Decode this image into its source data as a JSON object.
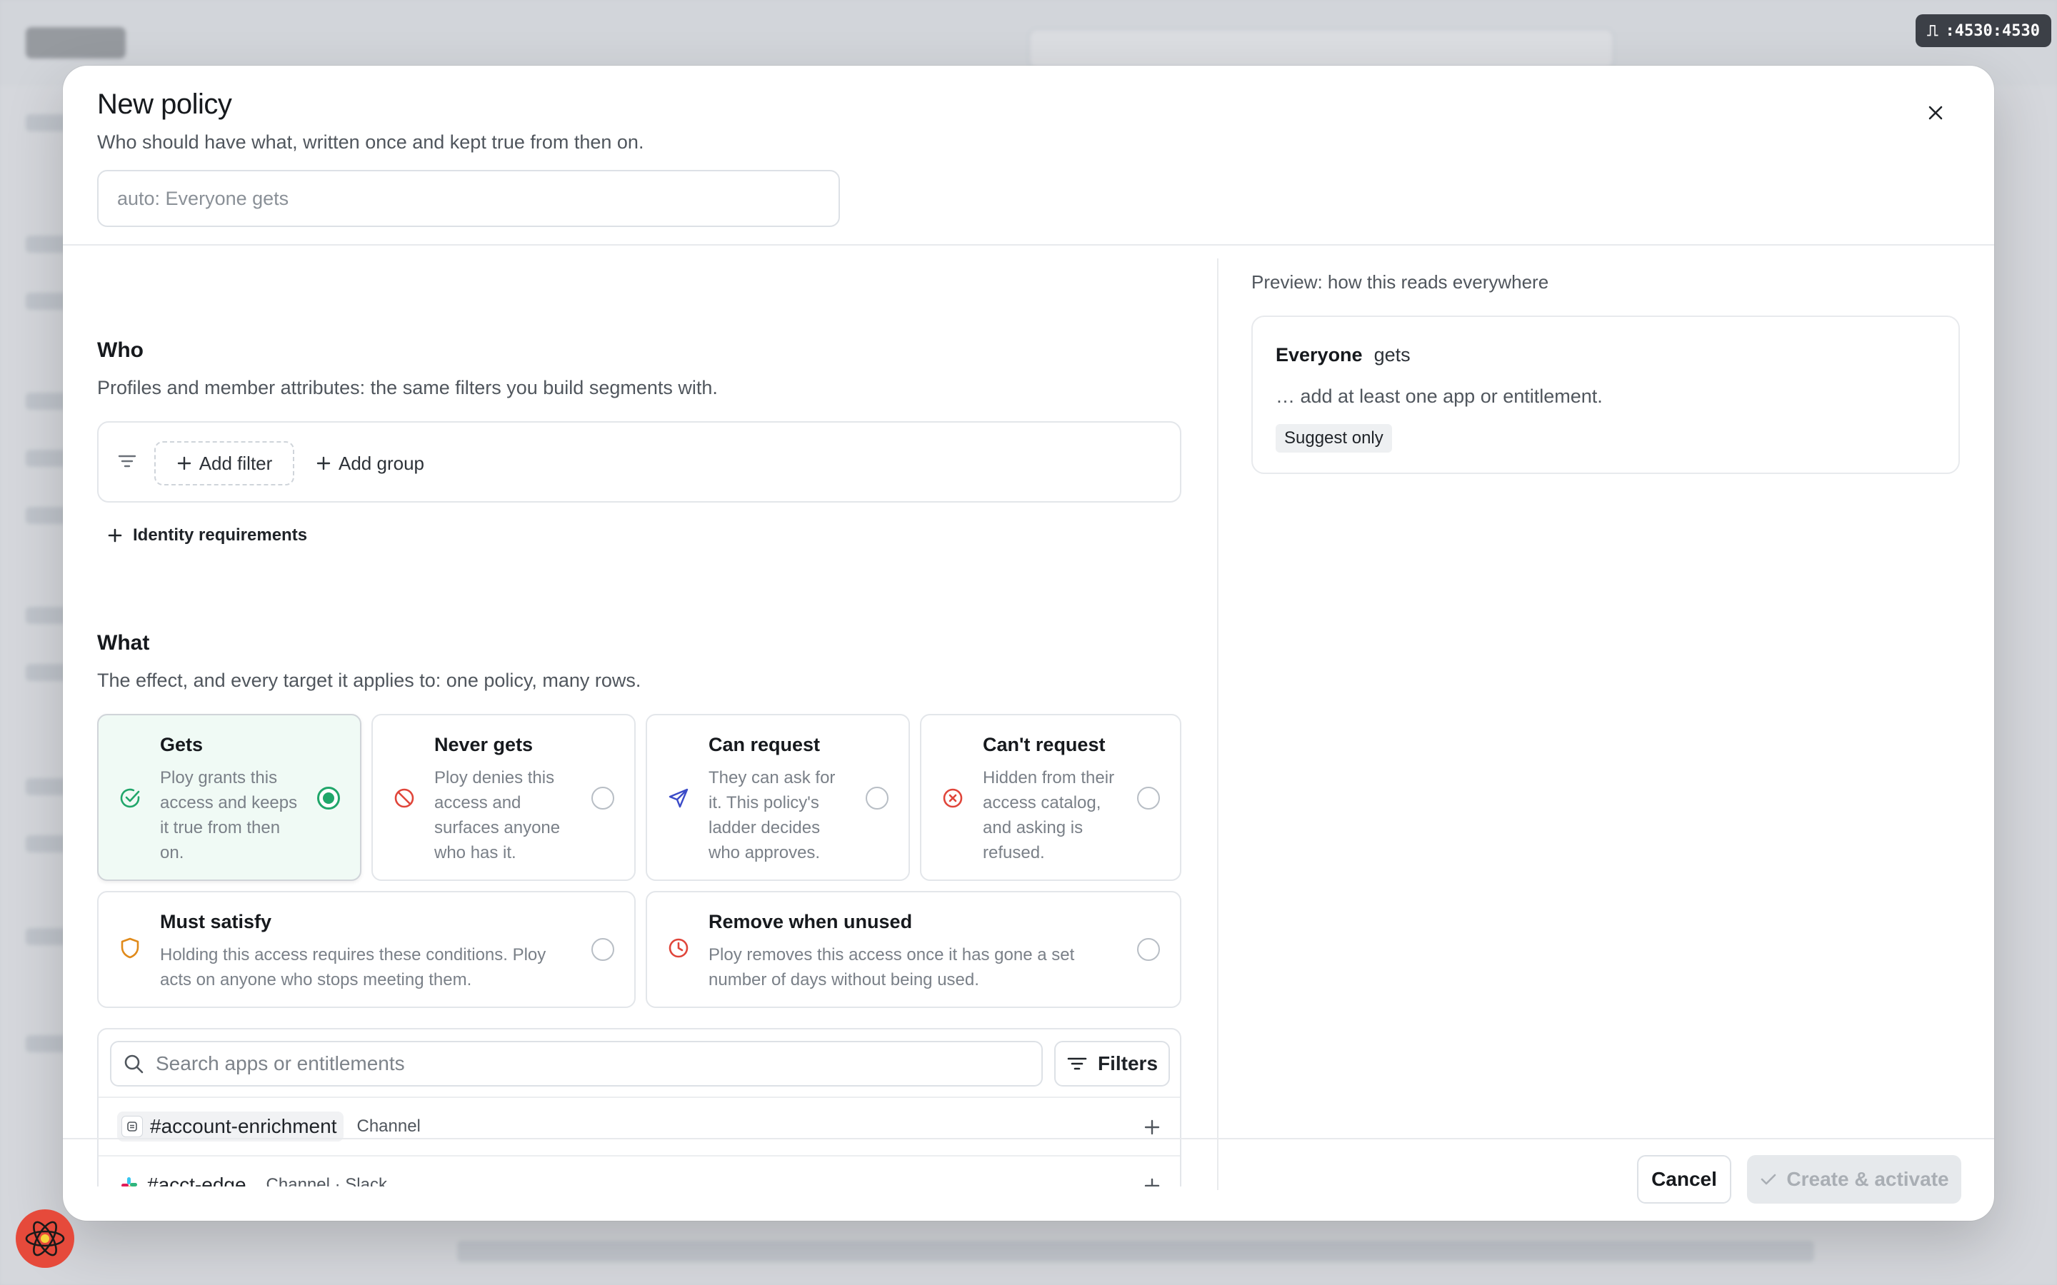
{
  "port_badge": ":4530:4530",
  "modal": {
    "title": "New policy",
    "subtitle": "Who should have what, written once and kept true from then on.",
    "name_placeholder": "auto: Everyone gets"
  },
  "who": {
    "title": "Who",
    "description": "Profiles and member attributes: the same filters you build segments with.",
    "add_filter": "Add filter",
    "add_group": "Add group",
    "identity_requirements": "Identity requirements"
  },
  "what": {
    "title": "What",
    "description": "The effect, and every target it applies to: one policy, many rows.",
    "effects": [
      {
        "title": "Gets",
        "lines": [
          "Ploy grants this",
          "access and keeps",
          "it true from then",
          "on."
        ],
        "selected": true,
        "icon": "check-circle-icon",
        "color": "#20a66a"
      },
      {
        "title": "Never gets",
        "lines": [
          "Ploy denies this",
          "access and",
          "surfaces anyone",
          "who has it."
        ],
        "selected": false,
        "icon": "ban-icon",
        "color": "#e0453a"
      },
      {
        "title": "Can request",
        "lines": [
          "They can ask for",
          "it. This policy's",
          "ladder decides",
          "who approves."
        ],
        "selected": false,
        "icon": "send-icon",
        "color": "#3b4bc8"
      },
      {
        "title": "Can't request",
        "lines": [
          "Hidden from their",
          "access catalog,",
          "and asking is",
          "refused."
        ],
        "selected": false,
        "icon": "x-circle-icon",
        "color": "#e0453a"
      },
      {
        "title": "Must satisfy",
        "lines": [
          "Holding this access requires these conditions. Ploy",
          "acts on anyone who stops meeting them."
        ],
        "selected": false,
        "icon": "shield-icon",
        "color": "#e08a1a"
      },
      {
        "title": "Remove when unused",
        "lines": [
          "Ploy removes this access once it has gone a set",
          "number of days without being used."
        ],
        "selected": false,
        "icon": "clock-icon",
        "color": "#e0453a"
      }
    ],
    "search_placeholder": "Search apps or entitlements",
    "filters_label": "Filters",
    "results": [
      {
        "name": "#account-enrichment",
        "meta": "Channel",
        "icon": "channel-icon"
      },
      {
        "name": "#acct-edge",
        "meta": "Channel · Slack",
        "icon": "slack-icon"
      }
    ]
  },
  "preview": {
    "label": "Preview: how this reads everywhere",
    "who": "Everyone",
    "effect": "gets",
    "hint": "… add at least one app or entitlement.",
    "badge": "Suggest only"
  },
  "footer": {
    "cancel": "Cancel",
    "create": "Create & activate"
  }
}
